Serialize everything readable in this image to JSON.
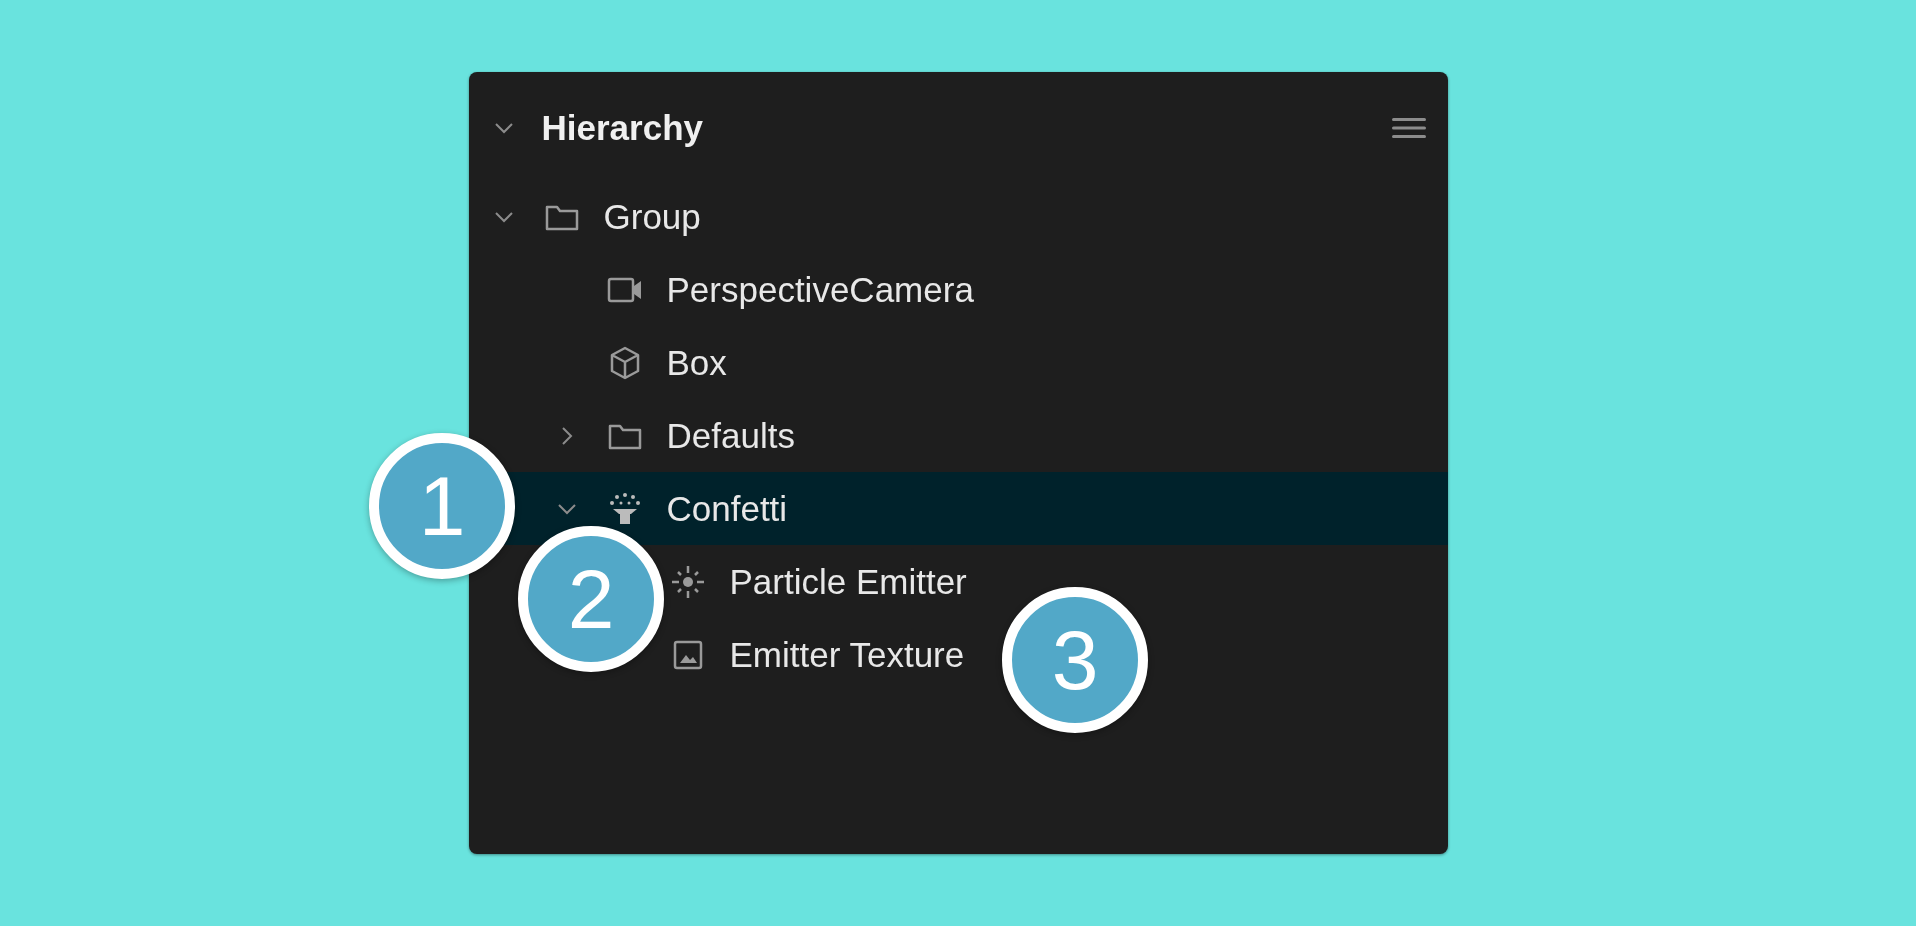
{
  "panel": {
    "title": "Hierarchy",
    "expanded": true
  },
  "tree": [
    {
      "label": "Group",
      "kind": "folder",
      "expanded": true,
      "selected": false,
      "children": [
        {
          "label": "PerspectiveCamera",
          "kind": "camera",
          "selected": false
        },
        {
          "label": "Box",
          "kind": "cube",
          "selected": false
        },
        {
          "label": "Defaults",
          "kind": "folder",
          "expanded": false,
          "selected": false
        },
        {
          "label": "Confetti",
          "kind": "confetti",
          "expanded": true,
          "selected": true,
          "children": [
            {
              "label": "Particle Emitter",
              "kind": "particle",
              "selected": false
            },
            {
              "label": "Emitter Texture",
              "kind": "image",
              "selected": false
            }
          ]
        }
      ]
    }
  ],
  "callouts": [
    {
      "label": "1"
    },
    {
      "label": "2"
    },
    {
      "label": "3"
    }
  ]
}
